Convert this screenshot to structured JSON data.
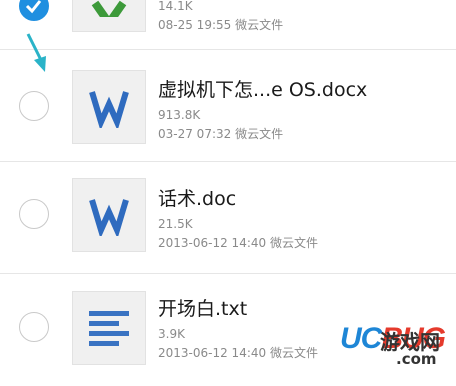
{
  "files": [
    {
      "name": "",
      "size": "14.1K",
      "meta": "08-25 19:55 微云文件",
      "icon": "excel-icon",
      "checked": true
    },
    {
      "name": "虚拟机下怎...e OS.docx",
      "size": "913.8K",
      "meta": "03-27 07:32 微云文件",
      "icon": "word-icon",
      "checked": false
    },
    {
      "name": "话术.doc",
      "size": "21.5K",
      "meta": "2013-06-12 14:40 微云文件",
      "icon": "word-icon",
      "checked": false
    },
    {
      "name": "开场白.txt",
      "size": "3.9K",
      "meta": "2013-06-12 14:40 微云文件",
      "icon": "text-file-icon",
      "checked": false
    }
  ],
  "watermark": {
    "uc": "UC",
    "bug": "BUG",
    "cn": "游戏网",
    "com": ".com"
  },
  "colors": {
    "accent": "#1f8fe0",
    "word": "#2f6bbf",
    "excel": "#3d9a3a",
    "text": "#3a73c2"
  }
}
